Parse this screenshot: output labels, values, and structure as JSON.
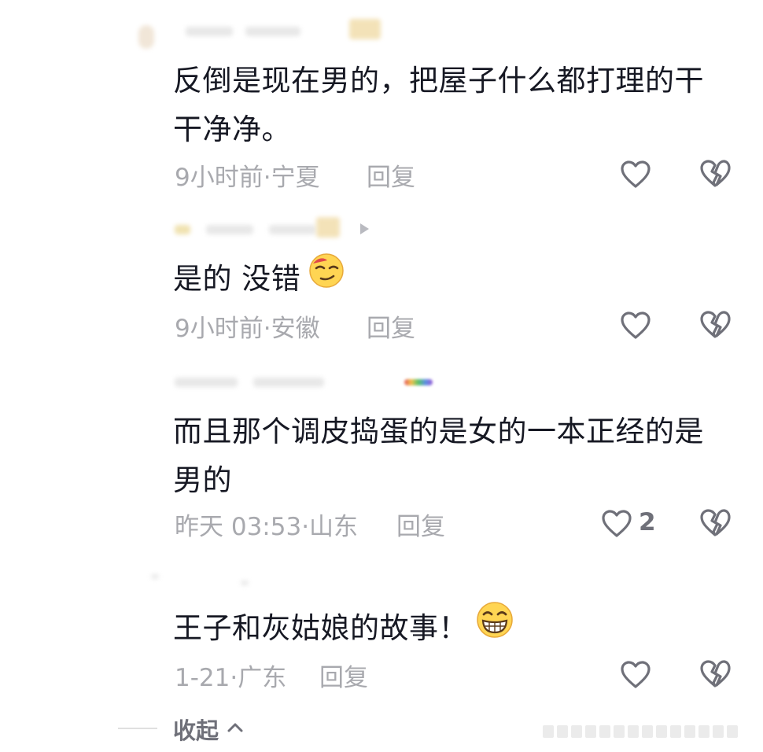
{
  "comments": [
    {
      "text": "反倒是现在男的，把屋子什么都打理的干干净净。",
      "meta": "9小时前·宁夏",
      "reply_label": "回复",
      "like_count": "",
      "emoji": ""
    },
    {
      "text": "是的 没错",
      "meta": "9小时前·安徽",
      "reply_label": "回复",
      "like_count": "",
      "emoji": "smirk-face"
    },
    {
      "text": "而且那个调皮捣蛋的是女的一本正经的是男的",
      "meta": "昨天 03:53·山东",
      "reply_label": "回复",
      "like_count": "2",
      "emoji": ""
    },
    {
      "text": "王子和灰姑娘的故事！",
      "meta": "1-21·广东",
      "reply_label": "回复",
      "like_count": "",
      "emoji": "grinning-face"
    }
  ],
  "collapse": {
    "label": "收起"
  },
  "icons": {
    "like": "heart-outline-icon",
    "dislike": "broken-heart-icon",
    "collapse": "chevron-up-icon"
  },
  "colors": {
    "text": "#161823",
    "meta": "#a8a9ae",
    "reply": "#6f7079",
    "icon": "#6f7079",
    "background": "#ffffff"
  }
}
